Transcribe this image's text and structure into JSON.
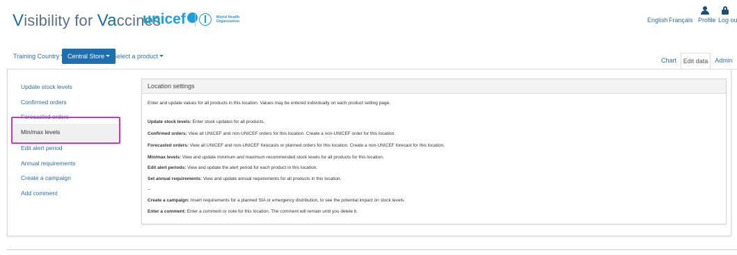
{
  "header": {
    "brand_v": "V",
    "brand_1": "isibility for ",
    "brand_va": "Va",
    "brand_2": "ccines",
    "unicef": "unicef",
    "who_line1": "World Health",
    "who_line2": "Organization",
    "lang_en": "English",
    "lang_fr": "Français",
    "profile": "Profile",
    "logout": "Log out"
  },
  "nav": {
    "country": "Training Country",
    "store": "Central Store",
    "product": "Select a product",
    "tab_chart": "Chart",
    "tab_edit": "Edit data",
    "tab_admin": "Admin"
  },
  "sidebar": {
    "items": [
      {
        "label": "Update stock levels"
      },
      {
        "label": "Confirmed orders"
      },
      {
        "label": "Forecasted orders"
      },
      {
        "label": "Min/max levels"
      },
      {
        "label": "Edit alert period"
      },
      {
        "label": "Annual requirements"
      },
      {
        "label": "Create a campaign"
      },
      {
        "label": "Add comment"
      }
    ]
  },
  "card": {
    "title": "Location settings",
    "intro": "Enter and update values for all products in this location. Values may be entered individually on each product setting page.",
    "rows": [
      {
        "term": "Update stock levels:",
        "desc": " Enter stock updates for all products."
      },
      {
        "term": "Confirmed orders:",
        "desc": " View all UNICEF and non-UNICEF orders for this location. Create a non-UNICEF order for this location."
      },
      {
        "term": "Forecasted orders:",
        "desc": " View all UNICEF and non-UNICEF forecasts or planned orders for this location. Create a non-UNICEF forecast for this location."
      },
      {
        "term": "Min/max levels:",
        "desc": " View and update minimum and maximum recommended stock levels for all products for this location."
      },
      {
        "term": "Edit alert periods:",
        "desc": " View and update the alert period for each product in this location."
      },
      {
        "term": "Set annual requirements:",
        "desc": " View and update annual requirements for all products in this location."
      }
    ],
    "separator": "--",
    "rows2": [
      {
        "term": "Create a campaign:",
        "desc": " Insert requirements for a planned SIA or emergency distribution, to see the potential impact on stock levels."
      },
      {
        "term": "Enter a comment:",
        "desc": " Enter a comment or note for this location. The comment will remain until you delete it."
      }
    ]
  },
  "colors": {
    "accent": "#1f6fb0",
    "link": "#2a6fa8",
    "highlight": "#d633b2",
    "unicef": "#1ca0dc"
  },
  "icons": [
    "globe-icon",
    "who-emblem-icon",
    "user-icon",
    "lock-icon",
    "caret-down-icon"
  ]
}
